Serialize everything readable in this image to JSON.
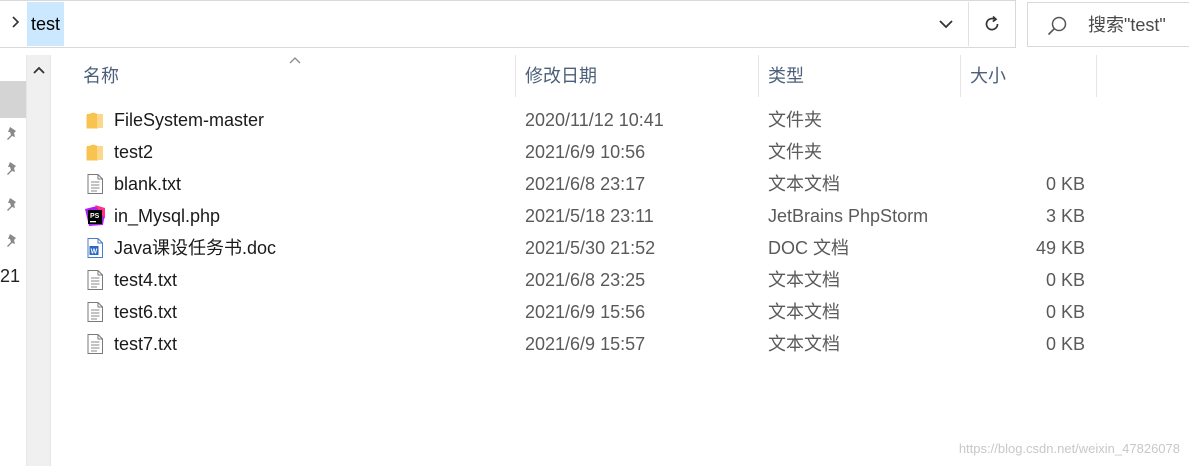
{
  "address": {
    "path_segment": "test"
  },
  "search": {
    "placeholder": "搜索\"test\""
  },
  "nav": {
    "partial_text": "21"
  },
  "columns": {
    "name": "名称",
    "date": "修改日期",
    "type": "类型",
    "size": "大小"
  },
  "files": [
    {
      "name": "FileSystem-master",
      "date": "2020/11/12 10:41",
      "type": "文件夹",
      "size": "",
      "icon": "folder-icon"
    },
    {
      "name": "test2",
      "date": "2021/6/9 10:56",
      "type": "文件夹",
      "size": "",
      "icon": "folder-icon"
    },
    {
      "name": "blank.txt",
      "date": "2021/6/8 23:17",
      "type": "文本文档",
      "size": "0 KB",
      "icon": "text-file-icon"
    },
    {
      "name": "in_Mysql.php",
      "date": "2021/5/18 23:11",
      "type": "JetBrains PhpStorm",
      "size": "3 KB",
      "icon": "phpstorm-icon"
    },
    {
      "name": "Java课设任务书.doc",
      "date": "2021/5/30 21:52",
      "type": "DOC 文档",
      "size": "49 KB",
      "icon": "word-doc-icon"
    },
    {
      "name": "test4.txt",
      "date": "2021/6/8 23:25",
      "type": "文本文档",
      "size": "0 KB",
      "icon": "text-file-icon"
    },
    {
      "name": "test6.txt",
      "date": "2021/6/9 15:56",
      "type": "文本文档",
      "size": "0 KB",
      "icon": "text-file-icon"
    },
    {
      "name": "test7.txt",
      "date": "2021/6/9 15:57",
      "type": "文本文档",
      "size": "0 KB",
      "icon": "text-file-icon"
    }
  ],
  "watermark": "https://blog.csdn.net/weixin_47826078",
  "colors": {
    "selection": "#cce8ff",
    "header_text": "#4c607a",
    "folder": "#f8c44f"
  }
}
